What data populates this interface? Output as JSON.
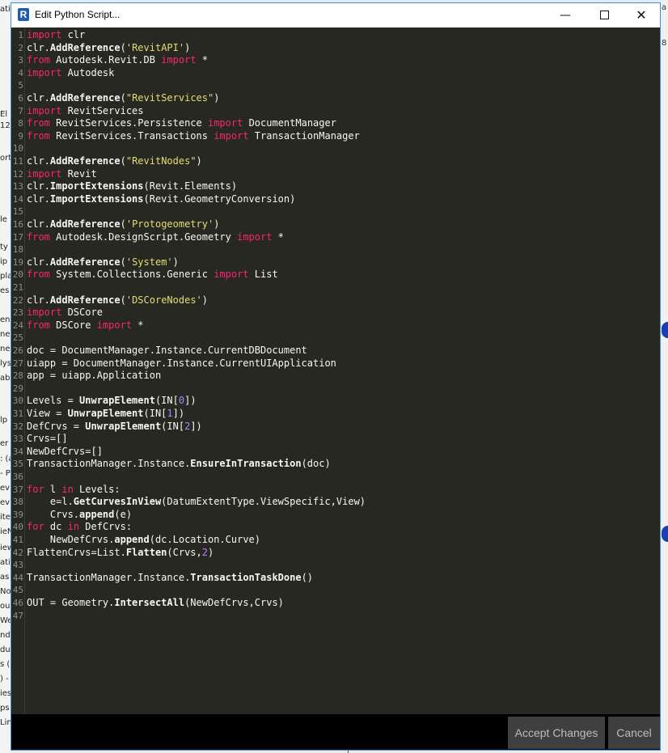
{
  "window": {
    "title": "Edit Python Script...",
    "app_icon_letter": "R",
    "minimize_glyph": "—",
    "close_glyph": "✕"
  },
  "footer": {
    "accept_label": "Accept Changes",
    "cancel_label": "Cancel"
  },
  "background_fragments": {
    "left": [
      "ati",
      "El",
      "12",
      "ort",
      "le",
      "ty",
      "ip",
      "pla",
      "es",
      "en",
      "ne",
      "ne",
      "lys",
      "ab",
      "lp",
      "er",
      ": (a",
      "- P",
      "ev",
      "ev",
      "ite",
      "ieN",
      "iew",
      "atio",
      "as",
      "No",
      "ou",
      "We",
      "nd",
      "dul",
      "s (",
      ") -",
      "ies",
      "ps",
      "Lin"
    ],
    "right": [
      "a",
      "8"
    ]
  },
  "code": {
    "language": "python",
    "lines": [
      {
        "n": 1,
        "text": "import clr"
      },
      {
        "n": 2,
        "text": "clr.AddReference('RevitAPI')"
      },
      {
        "n": 3,
        "text": "from Autodesk.Revit.DB import *"
      },
      {
        "n": 4,
        "text": "import Autodesk"
      },
      {
        "n": 5,
        "text": ""
      },
      {
        "n": 6,
        "text": "clr.AddReference(\"RevitServices\")"
      },
      {
        "n": 7,
        "text": "import RevitServices"
      },
      {
        "n": 8,
        "text": "from RevitServices.Persistence import DocumentManager"
      },
      {
        "n": 9,
        "text": "from RevitServices.Transactions import TransactionManager"
      },
      {
        "n": 10,
        "text": ""
      },
      {
        "n": 11,
        "text": "clr.AddReference(\"RevitNodes\")"
      },
      {
        "n": 12,
        "text": "import Revit"
      },
      {
        "n": 13,
        "text": "clr.ImportExtensions(Revit.Elements)"
      },
      {
        "n": 14,
        "text": "clr.ImportExtensions(Revit.GeometryConversion)"
      },
      {
        "n": 15,
        "text": ""
      },
      {
        "n": 16,
        "text": "clr.AddReference('Protogeometry')"
      },
      {
        "n": 17,
        "text": "from Autodesk.DesignScript.Geometry import *"
      },
      {
        "n": 18,
        "text": ""
      },
      {
        "n": 19,
        "text": "clr.AddReference('System')"
      },
      {
        "n": 20,
        "text": "from System.Collections.Generic import List"
      },
      {
        "n": 21,
        "text": ""
      },
      {
        "n": 22,
        "text": "clr.AddReference('DSCoreNodes')"
      },
      {
        "n": 23,
        "text": "import DSCore"
      },
      {
        "n": 24,
        "text": "from DSCore import *"
      },
      {
        "n": 25,
        "text": ""
      },
      {
        "n": 26,
        "text": "doc = DocumentManager.Instance.CurrentDBDocument"
      },
      {
        "n": 27,
        "text": "uiapp = DocumentManager.Instance.CurrentUIApplication"
      },
      {
        "n": 28,
        "text": "app = uiapp.Application"
      },
      {
        "n": 29,
        "text": ""
      },
      {
        "n": 30,
        "text": "Levels = UnwrapElement(IN[0])"
      },
      {
        "n": 31,
        "text": "View = UnwrapElement(IN[1])"
      },
      {
        "n": 32,
        "text": "DefCrvs = UnwrapElement(IN[2])"
      },
      {
        "n": 33,
        "text": "Crvs=[]"
      },
      {
        "n": 34,
        "text": "NewDefCrvs=[]"
      },
      {
        "n": 35,
        "text": "TransactionManager.Instance.EnsureInTransaction(doc)"
      },
      {
        "n": 36,
        "text": ""
      },
      {
        "n": 37,
        "text": "for l in Levels:"
      },
      {
        "n": 38,
        "text": "    e=l.GetCurvesInView(DatumExtentType.ViewSpecific,View)"
      },
      {
        "n": 39,
        "text": "    Crvs.append(e)"
      },
      {
        "n": 40,
        "text": "for dc in DefCrvs:"
      },
      {
        "n": 41,
        "text": "    NewDefCrvs.append(dc.Location.Curve)"
      },
      {
        "n": 42,
        "text": "FlattenCrvs=List.Flatten(Crvs,2)"
      },
      {
        "n": 43,
        "text": ""
      },
      {
        "n": 44,
        "text": "TransactionManager.Instance.TransactionTaskDone()"
      },
      {
        "n": 45,
        "text": ""
      },
      {
        "n": 46,
        "text": "OUT = Geometry.IntersectAll(NewDefCrvs,Crvs)"
      },
      {
        "n": 47,
        "text": ""
      }
    ]
  },
  "theme": {
    "editor_bg": "#272822",
    "keyword": "#f92672",
    "string": "#e6db74",
    "number": "#ae81ff",
    "text": "#f8f8f2",
    "gutter_text": "#8f908a",
    "footer_bg": "#000000",
    "button_bg": "#3f3f3f",
    "button_text": "#bdbdbd"
  }
}
